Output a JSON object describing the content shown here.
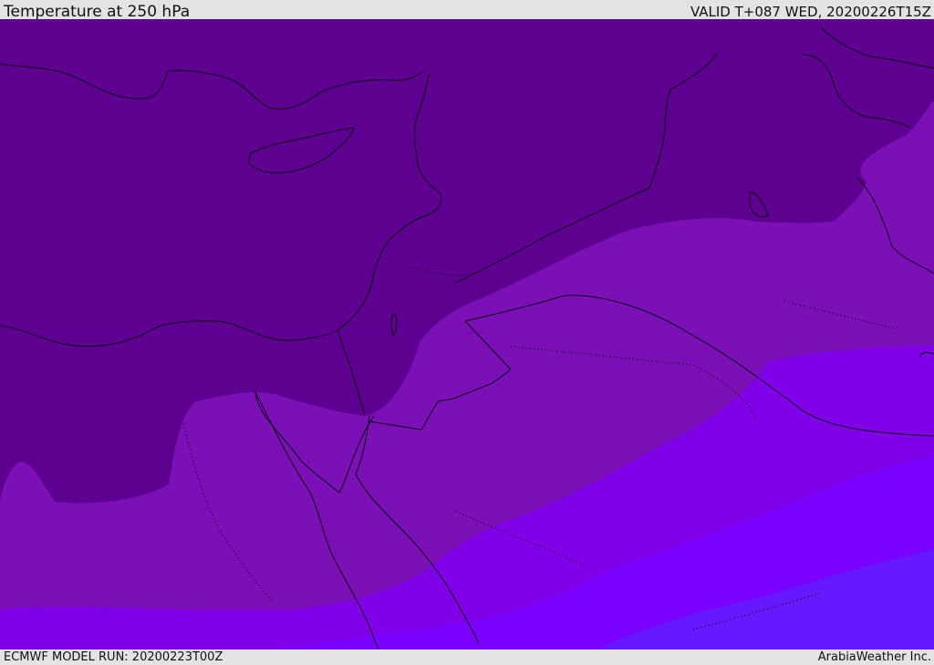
{
  "header": {
    "title": "Temperature at 250 hPa",
    "valid": "VALID T+087 WED, 20200226T15Z"
  },
  "footer": {
    "model_run": "ECMWF MODEL RUN: 20200223T00Z",
    "credit": "ArabiaWeather Inc."
  },
  "map": {
    "colors": {
      "band_coldest": "#5e0090",
      "band_2": "#6c00a8",
      "band_3": "#7a10b6",
      "band_4": "#8000e8",
      "band_5": "#7a00ff",
      "band_warmest": "#6618ff",
      "coastline": "#0b0b14"
    }
  }
}
